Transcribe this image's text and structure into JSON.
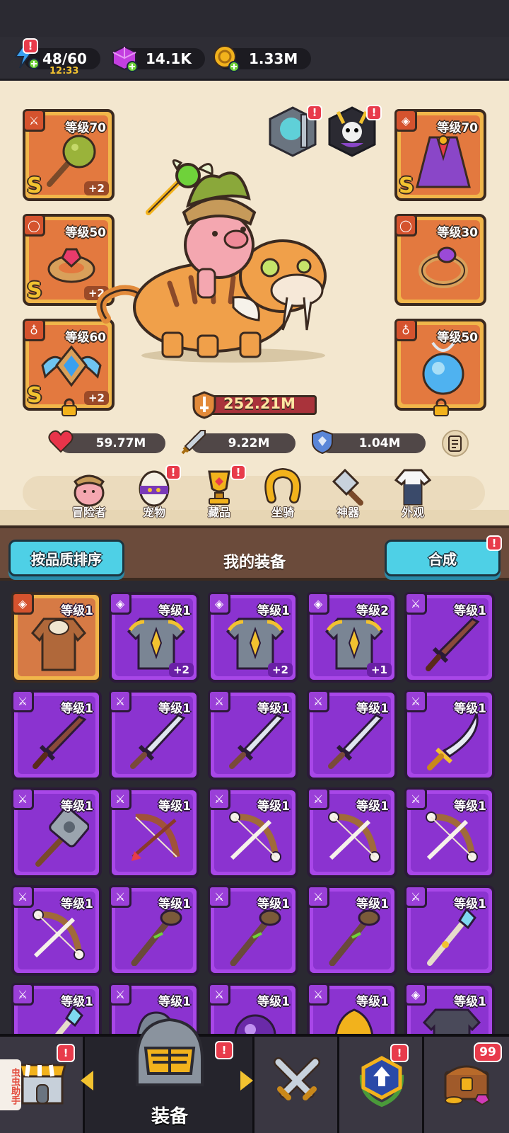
{
  "resources": {
    "energy": {
      "value": "48/60",
      "timer": "12:33"
    },
    "gems": {
      "value": "14.1K"
    },
    "gold": {
      "value": "1.33M"
    }
  },
  "hero": {
    "left_slots": [
      {
        "level": "等级70",
        "rank": "S",
        "plus": "+2",
        "item": "spiked-club"
      },
      {
        "level": "等级50",
        "rank": "S",
        "plus": "+2",
        "item": "ruby-bracelet"
      },
      {
        "level": "等级60",
        "rank": "S",
        "plus": "+2",
        "item": "winged-amulet"
      }
    ],
    "right_slots": [
      {
        "level": "等级70",
        "rank": "S",
        "item": "purple-cloak"
      },
      {
        "level": "等级30",
        "item": "amethyst-ring"
      },
      {
        "level": "等级50",
        "item": "blue-orb-necklace"
      }
    ],
    "power": "252.21M",
    "stats": {
      "hp": "59.77M",
      "attack": "9.22M",
      "defense": "1.04M"
    }
  },
  "nav": [
    {
      "label": "冒险者",
      "icon": "adventurer-icon"
    },
    {
      "label": "宠物",
      "icon": "pet-egg-icon"
    },
    {
      "label": "藏品",
      "icon": "trophy-icon"
    },
    {
      "label": "坐骑",
      "icon": "horseshoe-icon"
    },
    {
      "label": "神器",
      "icon": "hammer-icon"
    },
    {
      "label": "外观",
      "icon": "outfit-icon"
    }
  ],
  "inventory": {
    "sort_button": "按品质排序",
    "title": "我的装备",
    "merge_button": "合成",
    "items": [
      {
        "level": "等级1",
        "rarity": "white",
        "type": "armor",
        "item": "leather-armor"
      },
      {
        "level": "等级1",
        "rarity": "purple",
        "type": "armor",
        "item": "plate-armor",
        "plus": "+2"
      },
      {
        "level": "等级1",
        "rarity": "purple",
        "type": "armor",
        "item": "plate-armor",
        "plus": "+2"
      },
      {
        "level": "等级2",
        "rarity": "purple",
        "type": "armor",
        "item": "plate-armor",
        "plus": "+1"
      },
      {
        "level": "等级1",
        "rarity": "purple",
        "type": "weapon",
        "item": "wooden-sword"
      },
      {
        "level": "等级1",
        "rarity": "purple",
        "type": "weapon",
        "item": "wooden-sword"
      },
      {
        "level": "等级1",
        "rarity": "purple",
        "type": "weapon",
        "item": "steel-sword"
      },
      {
        "level": "等级1",
        "rarity": "purple",
        "type": "weapon",
        "item": "steel-sword"
      },
      {
        "level": "等级1",
        "rarity": "purple",
        "type": "weapon",
        "item": "steel-sword"
      },
      {
        "level": "等级1",
        "rarity": "purple",
        "type": "weapon",
        "item": "scimitar"
      },
      {
        "level": "等级1",
        "rarity": "purple",
        "type": "weapon",
        "item": "stone-hammer"
      },
      {
        "level": "等级1",
        "rarity": "purple",
        "type": "weapon",
        "item": "wooden-bow"
      },
      {
        "level": "等级1",
        "rarity": "purple",
        "type": "weapon",
        "item": "bone-bow"
      },
      {
        "level": "等级1",
        "rarity": "purple",
        "type": "weapon",
        "item": "bone-bow"
      },
      {
        "level": "等级1",
        "rarity": "purple",
        "type": "weapon",
        "item": "bone-bow"
      },
      {
        "level": "等级1",
        "rarity": "purple",
        "type": "weapon",
        "item": "bone-bow"
      },
      {
        "level": "等级1",
        "rarity": "purple",
        "type": "weapon",
        "item": "wooden-staff"
      },
      {
        "level": "等级1",
        "rarity": "purple",
        "type": "weapon",
        "item": "wooden-staff"
      },
      {
        "level": "等级1",
        "rarity": "purple",
        "type": "weapon",
        "item": "wooden-staff"
      },
      {
        "level": "等级1",
        "rarity": "purple",
        "type": "weapon",
        "item": "crystal-staff"
      },
      {
        "level": "等级1",
        "rarity": "purple",
        "type": "weapon",
        "item": "crystal-staff"
      },
      {
        "level": "等级1",
        "rarity": "purple",
        "type": "weapon",
        "item": "helmet"
      },
      {
        "level": "等级1",
        "rarity": "purple",
        "type": "weapon",
        "item": "purple-orb"
      },
      {
        "level": "等级1",
        "rarity": "purple",
        "type": "weapon",
        "item": "golden-bell"
      },
      {
        "level": "等级1",
        "rarity": "purple",
        "type": "armor",
        "item": "dark-armor"
      }
    ]
  },
  "tabs": {
    "active_label": "装备",
    "chest_count": "99",
    "helper_text": "虫虫助手"
  },
  "colors": {
    "purple_card": "#a847e8",
    "white_card": "#f1b64a",
    "accent_blue": "#4ed0e6",
    "alert_red": "#e83b4b",
    "hero_bg": "#f3e7cf"
  }
}
